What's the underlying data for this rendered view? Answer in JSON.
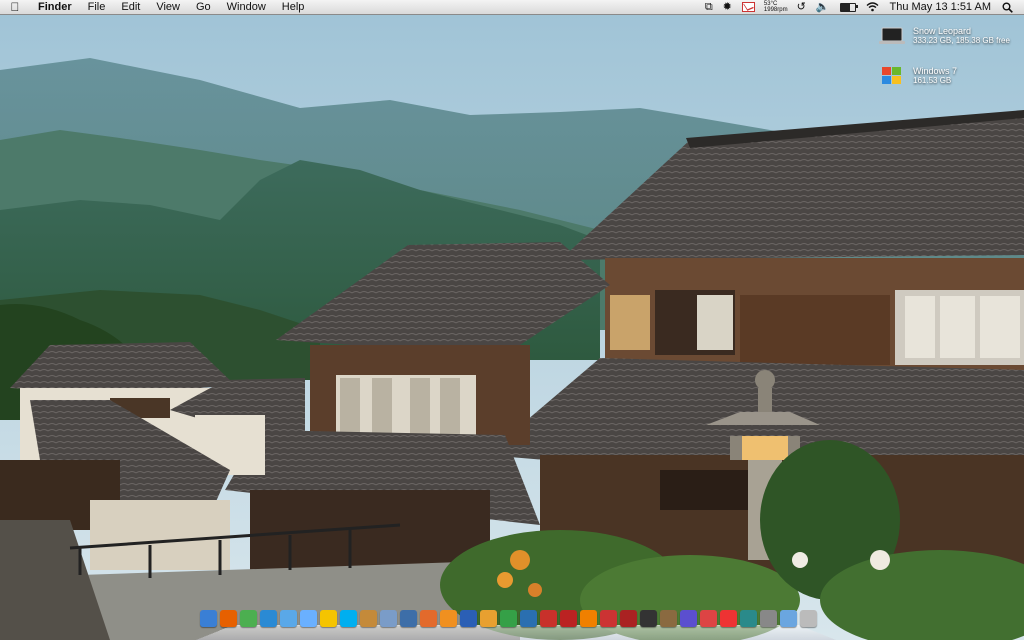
{
  "menubar": {
    "apple": "",
    "menus": [
      "Finder",
      "File",
      "Edit",
      "View",
      "Go",
      "Window",
      "Help"
    ],
    "status_icons": [
      "dropbox-icon",
      "growl-icon",
      "gmail-icon",
      "weather-icon",
      "time-machine-icon",
      "volume-icon",
      "battery-icon",
      "wifi-icon",
      "spotlight-icon"
    ],
    "temp": "53°C",
    "temp_rpm": "1998rpm",
    "clock": "Thu May 13  1:51 AM"
  },
  "drives": [
    {
      "name": "Snow Leopard",
      "info": "333.23 GB, 185.38 GB free",
      "icon": "macbook-drive-icon"
    },
    {
      "name": "Windows 7",
      "info": "161.53 GB",
      "icon": "windows-drive-icon"
    }
  ],
  "dock": {
    "apps": [
      {
        "name": "finder-icon",
        "color": "#3a7fd5"
      },
      {
        "name": "firefox-icon",
        "color": "#e66000"
      },
      {
        "name": "chrome-icon",
        "color": "#4caf50"
      },
      {
        "name": "safari-icon",
        "color": "#2a8ad4"
      },
      {
        "name": "itunes-icon",
        "color": "#5aa8e8"
      },
      {
        "name": "ichat-icon",
        "color": "#6ab0ff"
      },
      {
        "name": "aim-icon",
        "color": "#f5c400"
      },
      {
        "name": "skype-icon",
        "color": "#00aff0"
      },
      {
        "name": "home-icon",
        "color": "#c48a3a"
      },
      {
        "name": "preview-icon",
        "color": "#7a9cc8"
      },
      {
        "name": "xcode-icon",
        "color": "#3d6ea8"
      },
      {
        "name": "keynote-icon",
        "color": "#e26a2c"
      },
      {
        "name": "sketchbook-icon",
        "color": "#f09020"
      },
      {
        "name": "word-icon",
        "color": "#2b5fb5"
      },
      {
        "name": "pages-icon",
        "color": "#e8a030"
      },
      {
        "name": "dreamweaver-icon",
        "color": "#35a047"
      },
      {
        "name": "photoshop-icon",
        "color": "#2a6fb0"
      },
      {
        "name": "flash-icon",
        "color": "#c8312b"
      },
      {
        "name": "filezilla-icon",
        "color": "#b22"
      },
      {
        "name": "vlc-icon",
        "color": "#f08000"
      },
      {
        "name": "transmission-icon",
        "color": "#c33"
      },
      {
        "name": "photo-booth-icon",
        "color": "#a22"
      },
      {
        "name": "steam-icon",
        "color": "#333"
      },
      {
        "name": "gimp-icon",
        "color": "#8a6a40"
      },
      {
        "name": "network-icon",
        "color": "#5b4fcf"
      },
      {
        "name": "widget-icon",
        "color": "#d44"
      },
      {
        "name": "calendar-icon",
        "color": "#e33"
      },
      {
        "name": "time-machine-icon",
        "color": "#2a8a8a"
      },
      {
        "name": "system-preferences-icon",
        "color": "#888"
      },
      {
        "name": "folder-icon",
        "color": "#6aa6e0"
      },
      {
        "name": "trash-icon",
        "color": "#bbb"
      }
    ]
  }
}
